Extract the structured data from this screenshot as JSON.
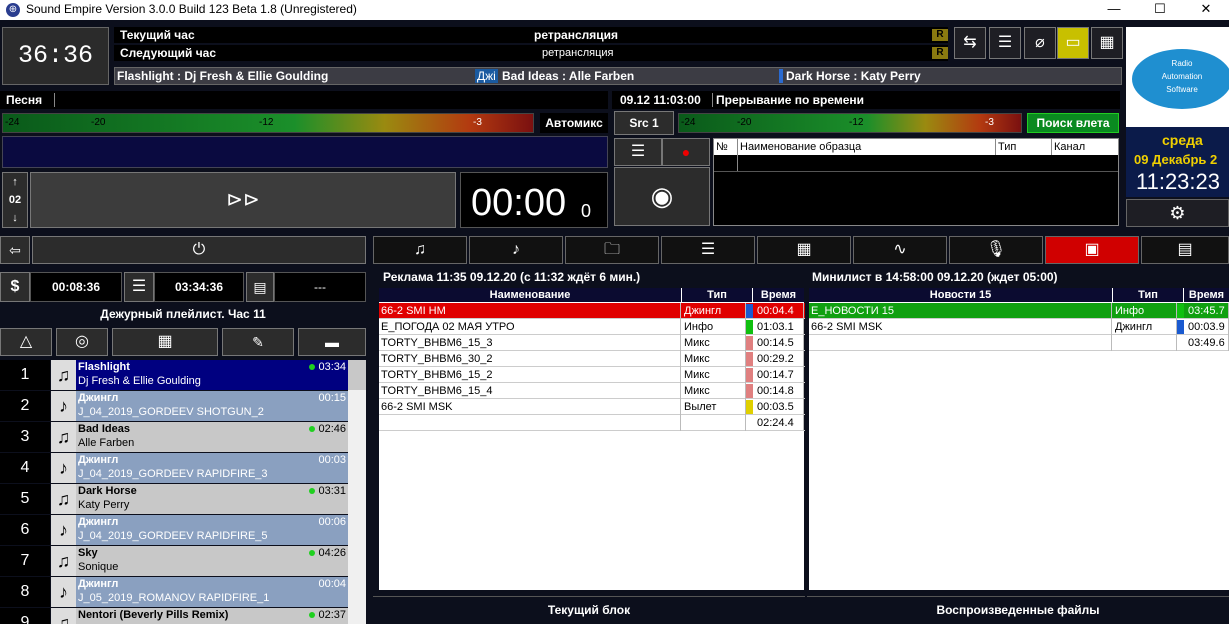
{
  "window": {
    "title": "Sound Empire Version 3.0.0 Build 123 Beta 1.8  (Unregistered)"
  },
  "clock": {
    "time": "36:36"
  },
  "hours": {
    "current_label": "Текущий час",
    "current_value": "ретрансляция",
    "next_label": "Следующий час",
    "next_value": "ретрансляция",
    "badge": "R"
  },
  "queue": {
    "item1": "Flashlight : Dj Fresh & Ellie Goulding",
    "item2_prefix": "Джі",
    "item2": "Bad Ideas : Alle Farben",
    "item3": "Dark Horse : Katy Perry"
  },
  "brand": {
    "line1": "Radio",
    "line2": "Automation",
    "line3": "Software"
  },
  "date": {
    "weekday": "среда",
    "date": "09 Декабрь 2",
    "time": "11:23:23"
  },
  "song": {
    "label": "Песня",
    "automix": "Автомикс",
    "counter": "02",
    "timer_main": "00:00",
    "timer_frac": "0"
  },
  "vu": {
    "t1": "-24",
    "t2": "-20",
    "t3": "-12",
    "t4": "-3"
  },
  "interrupt": {
    "datetime": "09.12 11:03:00",
    "label": "Прерывание по времени",
    "src": "Src 1",
    "search": "Поиск влета"
  },
  "samples": {
    "col_num": "№№",
    "col_name": "Наименование образца",
    "col_type": "Тип",
    "col_channel": "Канал"
  },
  "tabs": {
    "icons": [
      "music-multi-icon",
      "music-note-icon",
      "folder-music-icon",
      "list-icon",
      "clapper-icon",
      "waveform-icon",
      "microphone-icon",
      "calendar-icon",
      "document-icon"
    ]
  },
  "left_counters": {
    "dollar": "$",
    "t1": "00:08:36",
    "t2": "03:34:36",
    "t3": "---"
  },
  "playlist": {
    "title": "Дежурный плейлист. Час 11",
    "items": [
      {
        "n": "1",
        "title": "Flashlight",
        "sub": "Dj Fresh & Ellie Goulding",
        "dur": "03:34"
      },
      {
        "n": "2",
        "title": "Джингл",
        "sub": "J_04_2019_GORDEEV SHOTGUN_2",
        "dur": "00:15"
      },
      {
        "n": "3",
        "title": "Bad Ideas",
        "sub": "Alle Farben",
        "dur": "02:46"
      },
      {
        "n": "4",
        "title": "Джингл",
        "sub": "J_04_2019_GORDEEV RAPIDFIRE_3",
        "dur": "00:03"
      },
      {
        "n": "5",
        "title": "Dark Horse",
        "sub": "Katy Perry",
        "dur": "03:31"
      },
      {
        "n": "6",
        "title": "Джингл",
        "sub": "J_04_2019_GORDEEV RAPIDFIRE_5",
        "dur": "00:06"
      },
      {
        "n": "7",
        "title": "Sky",
        "sub": "Sonique",
        "dur": "04:26"
      },
      {
        "n": "8",
        "title": "Джингл",
        "sub": "J_05_2019_ROMANOV RAPIDFIRE_1",
        "dur": "00:04"
      },
      {
        "n": "9",
        "title": "Nentori (Beverly Pills Remix)",
        "sub": "",
        "dur": "02:37"
      }
    ]
  },
  "ads": {
    "title": "Реклама 11:35 09.12.20 (с 11:32 ждёт 6 мин.)",
    "col_name": "Наименование",
    "col_type": "Тип",
    "col_time": "Время",
    "rows": [
      {
        "name": "66-2 SMI HM",
        "type": "Джингл",
        "time": "00:04.4"
      },
      {
        "name": "E_ПОГОДА 02 МАЯ УТРО",
        "type": "Инфо",
        "time": "01:03.1"
      },
      {
        "name": "TORTY_ВНВМ6_15_3",
        "type": "Микс",
        "time": "00:14.5"
      },
      {
        "name": "TORTY_ВНВМ6_30_2",
        "type": "Микс",
        "time": "00:29.2"
      },
      {
        "name": "TORTY_ВНВМ6_15_2",
        "type": "Микс",
        "time": "00:14.7"
      },
      {
        "name": "TORTY_ВНВМ6_15_4",
        "type": "Микс",
        "time": "00:14.8"
      },
      {
        "name": "66-2 SMI MSK",
        "type": "Вылет",
        "time": "00:03.5"
      },
      {
        "name": "",
        "type": "",
        "time": "02:24.4"
      }
    ]
  },
  "minilist": {
    "title": "Минилист в 14:58:00 09.12.20 (ждет 05:00)",
    "col_name": "Новости 15",
    "col_type": "Тип",
    "col_time": "Время",
    "rows": [
      {
        "name": "E_НОВОСТИ 15",
        "type": "Инфо",
        "time": "03:45.7"
      },
      {
        "name": "66-2 SMI MSK",
        "type": "Джингл",
        "time": "00:03.9"
      },
      {
        "name": "",
        "type": "",
        "time": "03:49.6"
      }
    ]
  },
  "bottom": {
    "current_block": "Текущий блок",
    "played_files": "Воспроизведенные файлы"
  }
}
